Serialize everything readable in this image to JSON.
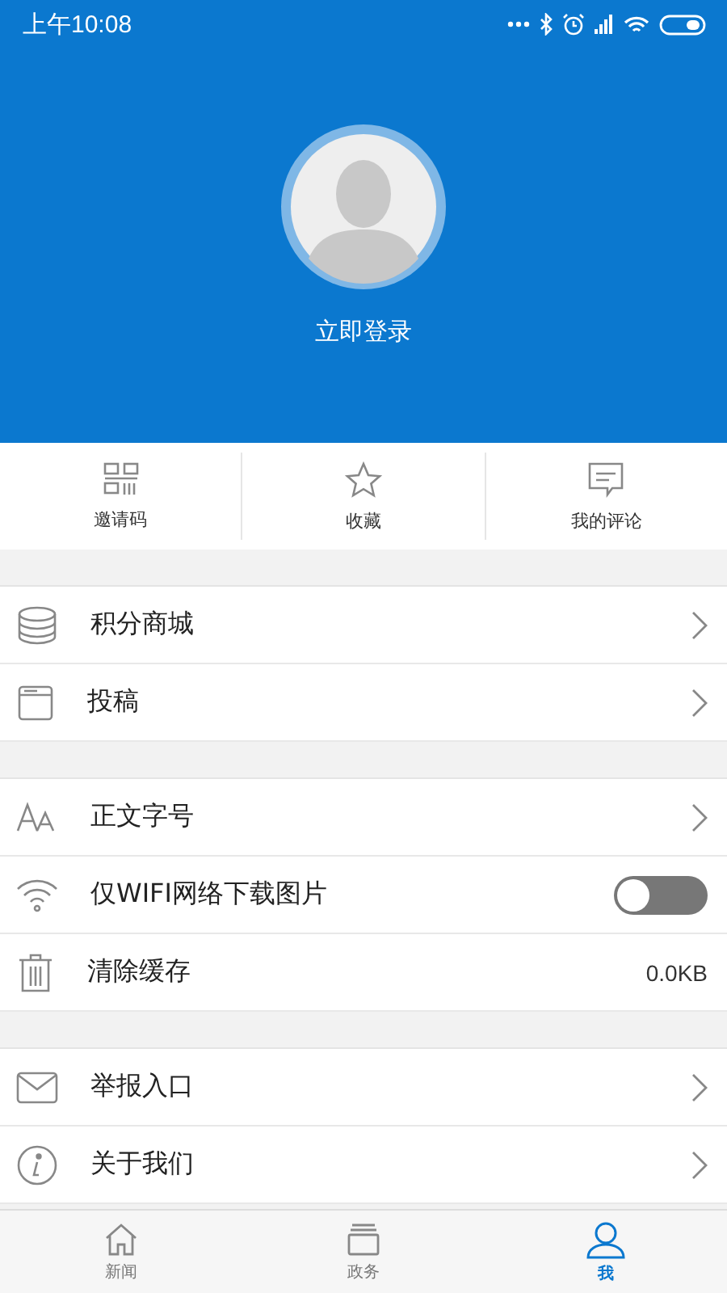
{
  "status_bar": {
    "time": "上午10:08"
  },
  "profile": {
    "login_label": "立即登录"
  },
  "quick_actions": [
    {
      "label": "邀请码"
    },
    {
      "label": "收藏"
    },
    {
      "label": "我的评论"
    }
  ],
  "sections": [
    {
      "items": [
        {
          "kind": "link",
          "label": "积分商城"
        },
        {
          "kind": "link",
          "label": "投稿"
        }
      ]
    },
    {
      "items": [
        {
          "kind": "link",
          "label": "正文字号"
        },
        {
          "kind": "toggle",
          "label": "仅WIFI网络下载图片",
          "on": false
        },
        {
          "kind": "value",
          "label": "清除缓存",
          "value": "0.0KB"
        }
      ]
    },
    {
      "items": [
        {
          "kind": "link",
          "label": "举报入口"
        },
        {
          "kind": "link",
          "label": "关于我们"
        }
      ]
    }
  ],
  "tab_bar": [
    {
      "label": "新闻",
      "selected": false
    },
    {
      "label": "政务",
      "selected": false
    },
    {
      "label": "我",
      "selected": true
    }
  ]
}
